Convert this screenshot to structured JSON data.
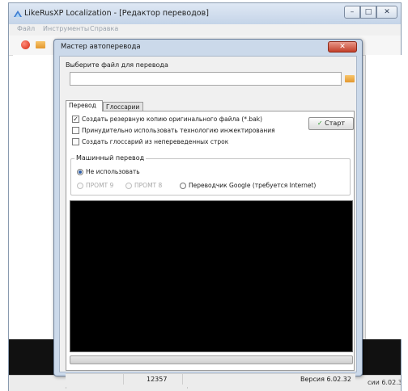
{
  "main_window": {
    "title": "LikeRusXP Localization - [Редактор переводов]",
    "menu": [
      "Файл",
      "Инструменты",
      "Справка"
    ],
    "status_count": "12357",
    "status_version_partial": "сии 6.02.32",
    "caption_min": "–",
    "caption_max": "□",
    "caption_close": "✕"
  },
  "dialog": {
    "title": "Мастер автоперевода",
    "close_glyph": "✕",
    "file_label": "Выберите файл для перевода",
    "file_value": "",
    "tabs": [
      "Перевод",
      "Глоссарии"
    ],
    "options": [
      {
        "label": "Создать резервную копию оригинального файла (*.bak)",
        "checked": true,
        "mark": "✓"
      },
      {
        "label": "Принудительно использовать технологию инжектирования",
        "checked": false,
        "mark": ""
      },
      {
        "label": "Создать глоссарий из непереведенных строк",
        "checked": false,
        "mark": ""
      }
    ],
    "start_button": "Старт",
    "start_icon": "✓",
    "machine_translation": {
      "legend": "Машинный перевод",
      "options": [
        {
          "label": "Не использовать",
          "selected": true,
          "enabled": true
        },
        {
          "label": "ПРОМТ 9",
          "selected": false,
          "enabled": false
        },
        {
          "label": "ПРОМТ 8",
          "selected": false,
          "enabled": false
        },
        {
          "label": "Переводчик Google (требуется Internet)",
          "selected": false,
          "enabled": true
        }
      ]
    },
    "status_count": "12357",
    "status_version": "Версия 6.02.32"
  },
  "colors": {
    "dialog_frame": "#cbd9ea",
    "close_red": "#c3402a",
    "log_background": "#000000",
    "start_check": "#2e9a2e"
  },
  "icons": {
    "app": "app-logo-icon",
    "folder": "folder-icon",
    "record": "record-icon"
  }
}
